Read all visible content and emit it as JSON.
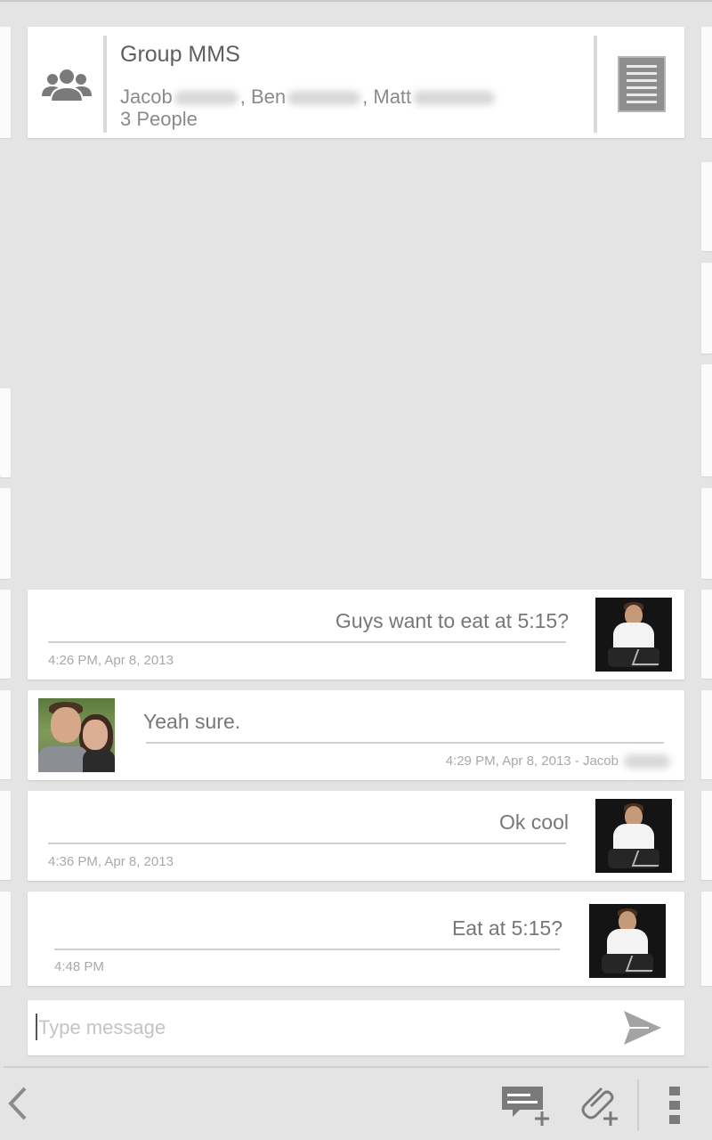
{
  "header": {
    "title": "Group MMS",
    "members": [
      {
        "first": "Jacob"
      },
      {
        "first": "Ben"
      },
      {
        "first": "Matt"
      }
    ],
    "sep1": ",",
    "sep2": ",",
    "count": "3 People"
  },
  "messages": [
    {
      "text": "Guys want to eat at 5:15?",
      "time": "4:26 PM, Apr 8, 2013",
      "sender": "me"
    },
    {
      "text": "Yeah sure.",
      "time": "4:29 PM, Apr 8, 2013 - Jacob",
      "sender": "Jacob"
    },
    {
      "text": "Ok cool",
      "time": "4:36 PM, Apr 8, 2013",
      "sender": "me"
    },
    {
      "text": "Eat at 5:15?",
      "time": "4:48 PM",
      "sender": "me"
    }
  ],
  "composer": {
    "placeholder": "Type message",
    "value": ""
  },
  "icons": {
    "group": "group-icon",
    "details": "document-icon",
    "send": "send-icon",
    "back": "back-chevron-icon",
    "new_message": "new-message-icon",
    "attach": "attach-icon",
    "overflow": "overflow-menu-icon"
  },
  "colors": {
    "background": "#e4e4e4",
    "card": "#ffffff",
    "icon": "#7a7a7a"
  }
}
